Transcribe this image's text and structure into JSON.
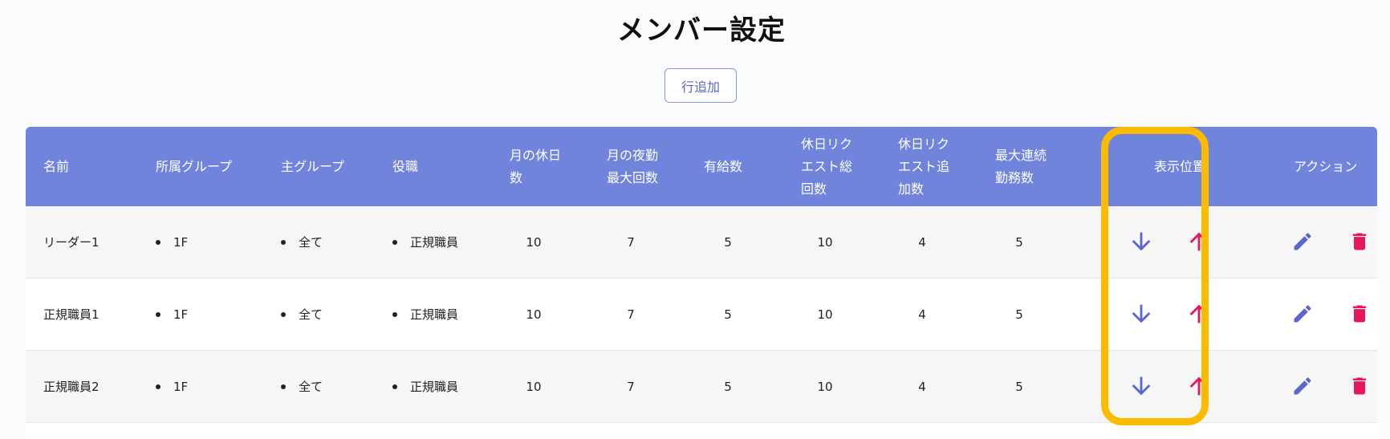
{
  "page": {
    "title": "メンバー設定"
  },
  "toolbar": {
    "add_row_label": "行追加"
  },
  "table": {
    "headers": {
      "name": "名前",
      "group": "所属グループ",
      "main_group": "主グループ",
      "role": "役職",
      "monthly_holidays": [
        "月の休日",
        "数"
      ],
      "max_night_shifts": [
        "月の夜勤",
        "最大回数"
      ],
      "paid_leave": "有給数",
      "holiday_request_total": [
        "休日リク",
        "エスト総",
        "回数"
      ],
      "holiday_request_extra": [
        "休日リク",
        "エスト追",
        "加数"
      ],
      "max_consecutive": [
        "最大連続",
        "勤務数"
      ],
      "position": "表示位置",
      "actions": "アクション"
    },
    "rows": [
      {
        "name": "リーダー1",
        "group": "1F",
        "main_group": "全て",
        "role": "正規職員",
        "monthly_holidays": "10",
        "max_night_shifts": "7",
        "paid_leave": "5",
        "holiday_request_total": "10",
        "holiday_request_extra": "4",
        "max_consecutive": "5"
      },
      {
        "name": "正規職員1",
        "group": "1F",
        "main_group": "全て",
        "role": "正規職員",
        "monthly_holidays": "10",
        "max_night_shifts": "7",
        "paid_leave": "5",
        "holiday_request_total": "10",
        "holiday_request_extra": "4",
        "max_consecutive": "5"
      },
      {
        "name": "正規職員2",
        "group": "1F",
        "main_group": "全て",
        "role": "正規職員",
        "monthly_holidays": "10",
        "max_night_shifts": "7",
        "paid_leave": "5",
        "holiday_request_total": "10",
        "holiday_request_extra": "4",
        "max_consecutive": "5"
      }
    ]
  },
  "icons": {
    "move_down": "arrow-down-icon",
    "move_up": "arrow-up-icon",
    "edit": "pencil-icon",
    "delete": "trash-icon"
  },
  "colors": {
    "header_bg": "#7084dc",
    "down_arrow": "#5b67cf",
    "up_arrow": "#e8175d",
    "edit_icon": "#5b67cf",
    "delete_icon": "#e8175d",
    "highlight": "#fbbb00"
  }
}
